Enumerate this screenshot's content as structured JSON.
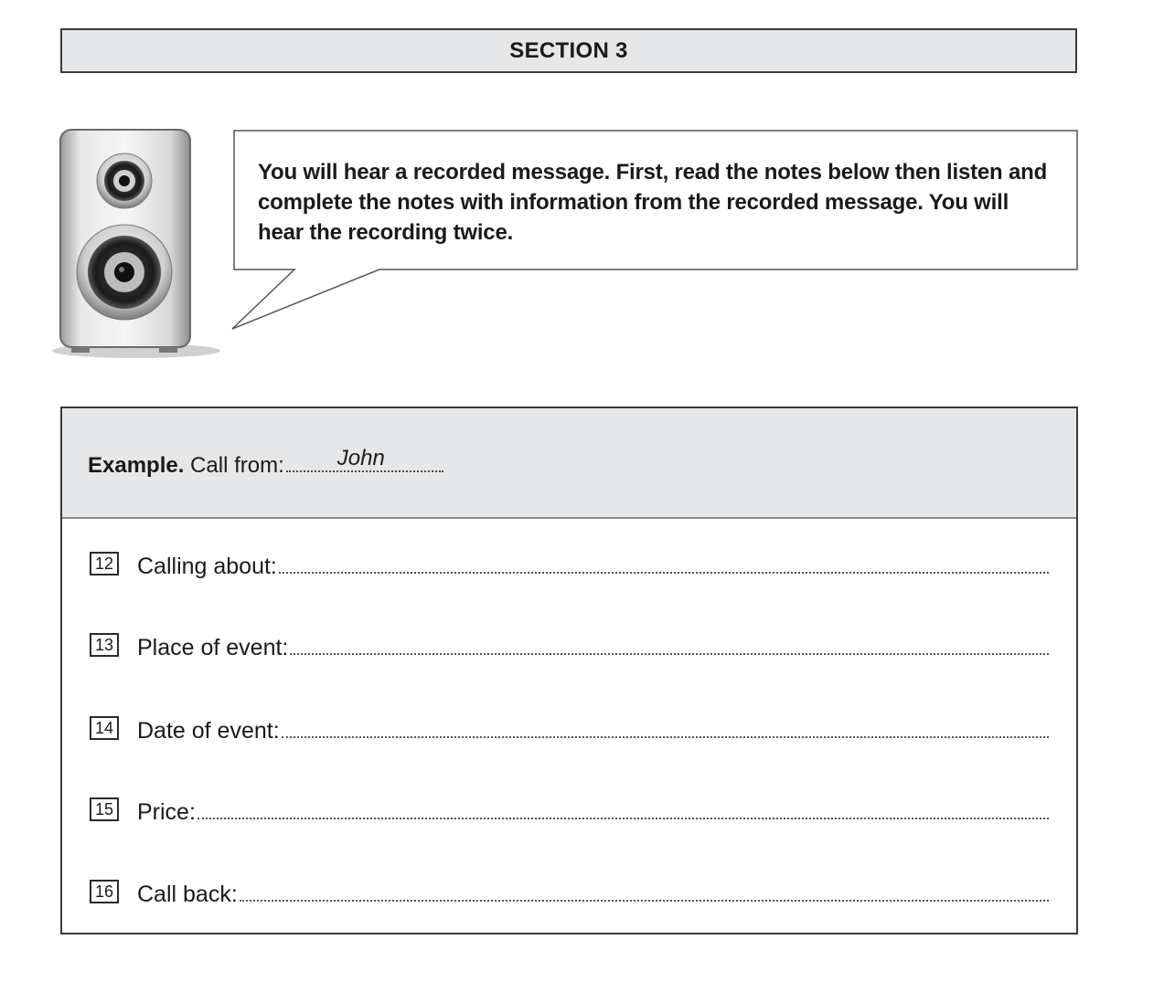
{
  "section": {
    "title": "SECTION 3"
  },
  "instructions": "You will hear a recorded message. First, read the notes below then listen and complete the notes with information from the recorded message. You will hear the recording twice.",
  "example": {
    "label_bold": "Example.",
    "label": " Call from:",
    "answer": "John"
  },
  "items": [
    {
      "number": "12",
      "label": "Calling about:"
    },
    {
      "number": "13",
      "label": "Place of event:"
    },
    {
      "number": "14",
      "label": "Date of event:"
    },
    {
      "number": "15",
      "label": "Price:"
    },
    {
      "number": "16",
      "label": "Call back:"
    }
  ],
  "icons": {
    "speaker": "speaker-icon"
  },
  "colors": {
    "band": "#e6e7e8",
    "border": "#3a3a3a"
  }
}
